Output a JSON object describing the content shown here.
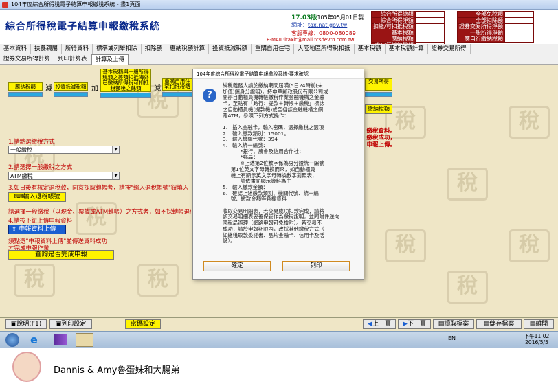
{
  "window": {
    "title": "104年度綜合所得稅電子結算申報繳稅系統 - 畫1頁面"
  },
  "header": {
    "app_title": "綜合所得稅電子結算申報繳稅系統",
    "version": "17.03版",
    "version_date": "105年05月01日製",
    "website_label": "網址：",
    "website": "tax.nat.gov.tw",
    "hotline": "客服專線：0800-080089",
    "email": "E-MAIL:itaxic@mail.tcsdevtn.com.tw",
    "summary_left": [
      "綜合所得總額",
      "綜合所得淨額",
      "扣繳/可扣抵稅額",
      "基本稅額",
      "應納稅額",
      "應自行繳納稅額"
    ],
    "summary_right": [
      "全部免稅額",
      "全部扣除額",
      "證券交易所得淨額",
      "一般所得淨額",
      "應自行繳納稅額"
    ]
  },
  "tabs_row1": [
    "基本資料",
    "扶養親屬",
    "所得資料",
    "標準或列舉扣除",
    "扣除額",
    "應納稅額計算",
    "投資抵減稅額",
    "重購自用住宅",
    "大陸地區所得稅扣抵",
    "基本稅額",
    "基本稅額計算",
    "證券交易所得"
  ],
  "tabs_row2": [
    "證券交易所得計算",
    "列印計算表",
    "計算及上傳"
  ],
  "active_tab": "計算及上傳",
  "flow": {
    "tax_payable": "應納稅額",
    "minus1": "減",
    "investment_credit": "投資抵減稅額",
    "plus": "加",
    "basic_vs_general": "基本稅額與一般所得稅額之差額扣抵海外已繳納所得稅可扣抵稅額後之餘額",
    "minus2": "減",
    "repurchase_credit": "重購自用住宅扣抵稅額",
    "securities": "交易所得",
    "pay_button": "繳納稅額"
  },
  "left_panel": {
    "step1": "1.請點選繳稅方式",
    "step1_value": "一般繳稅",
    "step2": "2.請選擇一般繳稅之方式",
    "step2_value": "ATM繳稅",
    "step3": "3.如日後有核定退稅款，同意採取轉帳者，請按\"輸入退稅帳號\"鈕填入",
    "refund_button": "輸入退稅帳號",
    "note_line": "請選擇一般繳稅（以現金、票據或ATM轉帳）之方式者，如不採轉帳退稅",
    "step4": "4.請按下鈕上傳申報資料",
    "upload_button": "申報資料上傳",
    "note2_line1": "須點選\"申報資料上傳\"並傳送資料成功",
    "note2_line2": "才完成申報作業",
    "query_button": "查詢是否完成申報"
  },
  "right_notice": [
    "繳稅資料。",
    "繳稅成功，",
    "申報上傳。"
  ],
  "dialog": {
    "title": "104年度綜合所得稅電子結算申報繳稅系統-要求確認",
    "icon": "question-icon",
    "body": "納稅義務人請於繳納期間屆滿(5日24時前(未\n加值)攜身分證明)，持中華郵政股份有限公司或\n開辦自動櫃員機轉帳繳稅作業金融機構之金融\n卡，至貼有「跨行：提款＋轉帳＋繳稅」標誌\n之自動櫃員機(提款機)或至各該金融機構之網\n路ATM，參照下列方式操作：\n\n1.   插入金融卡，輸入密碼，選擇繳稅之選項\n2.   輸入繳款類別：15001。\n3.   輸入機關代號：394\n4.   輸入統一編號：\n           *銀行、農會及信用合作社：\n           *郵局：\n           ※上述第2位數字係為身分證統一編號\n     第1位英文字母轉換而來，如自動櫃員\n     機上有顯示英文字母轉換數字對照表，\n           請依畫面顯示資料為主\n5.   輸入繳款金額：\n6.   確認上述繳款類別、機關代號、統一編\n     號、繳款金額等各欄資料\n\n收取交易明細表，若交易成功扣款完成，請將\n該交易明細表妥善保管作為繳稅證明，並同附件送向\n國稅局辦理（網路申報可免檢附）。若交易不\n成功，請於申報期限內，改採其他繳稅方式（\n如繳稅取款委託書、晶片金融卡、信用卡及活\n儲）。",
    "confirm": "確定",
    "print": "列印"
  },
  "bottom_buttons": {
    "help": "說明(F1)",
    "print_settings": "列印設定",
    "password": "密碼設定",
    "prev": "上一頁",
    "next": "下一頁",
    "read_file": "讀取檔案",
    "save_file": "儲存檔案",
    "exit": "離開"
  },
  "taskbar": {
    "lang": "EN",
    "time": "下午11:02",
    "date": "2016/5/5"
  },
  "footer": {
    "brand": "Dannis & Amy魯蛋妹和大腸弟"
  },
  "colors": {
    "accent_yellow": "#fff400",
    "field_blue": "#2aa8e0",
    "header_red": "#9a1414",
    "app_title_blue": "#0b2a8c"
  }
}
